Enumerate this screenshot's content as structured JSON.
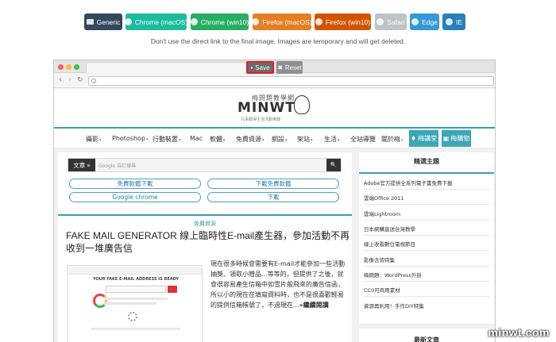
{
  "toolbar": {
    "buttons": [
      {
        "label": "Generic",
        "color": "#34495e",
        "icon": "desktop-icon"
      },
      {
        "label": "Chrome (macOS)",
        "color": "#1abc9c",
        "icon": "chrome-icon"
      },
      {
        "label": "Chrome (win10)",
        "color": "#27ae60",
        "icon": "chrome-icon"
      },
      {
        "label": "Firefox (macOS)",
        "color": "#e67e22",
        "icon": "firefox-icon"
      },
      {
        "label": "Firefox (win10)",
        "color": "#d35400",
        "icon": "firefox-icon"
      },
      {
        "label": "Safari",
        "color": "#bdc3c7",
        "icon": "safari-icon"
      },
      {
        "label": "Edge",
        "color": "#3498db",
        "icon": "edge-icon"
      },
      {
        "label": "IE",
        "color": "#2980b9",
        "icon": "ie-icon"
      }
    ],
    "notice": "Don't use the direct link to the final image. Images are temporary and will get deleted."
  },
  "overlay": {
    "save_label": "Save",
    "reset_label": "Reset",
    "save_color": "#6b6b6b",
    "save_border": "#e02020"
  },
  "browser": {
    "nav_back": "‹",
    "nav_forward": "›",
    "nav_reload": "↻"
  },
  "site": {
    "logo_cn": "梅問題教學網",
    "logo_en": "MINWT",
    "logo_sub": "凡事都得生活活動樂趣",
    "menu": [
      {
        "label": "攝影",
        "caret": "▾"
      },
      {
        "label": "Photoshop",
        "caret": "▾"
      },
      {
        "label": "行動裝置",
        "caret": "▾"
      },
      {
        "label": "Mac",
        "caret": ""
      },
      {
        "label": "軟體",
        "caret": "▾"
      },
      {
        "label": "免費資源",
        "caret": "▾"
      },
      {
        "label": "網設",
        "caret": "▾"
      },
      {
        "label": "架站",
        "caret": "▾"
      },
      {
        "label": "生活",
        "caret": "▾"
      },
      {
        "label": "全站導覽",
        "caret": ""
      },
      {
        "label": "關於梅",
        "caret": "▾"
      }
    ],
    "menu_btn_1": "梅講堂",
    "menu_btn_2": "梅購物",
    "accent": "#3b9eb0",
    "search": {
      "label": "文章",
      "label_arrow": "»",
      "placeholder": "Google 自訂搜尋",
      "button": "🔍"
    },
    "pills": [
      "免費軟體下載",
      "下載免費軟體",
      "Google chrome",
      "下載"
    ],
    "post": {
      "category": "免費資源",
      "title": "FAKE MAIL GENERATOR 線上臨時性E-mail產生器，參加活動不再收到一堆廣告信",
      "thumb_title": "YOUR FAKE E-MAIL ADDRESS IS READY",
      "excerpt": "現在很多時候會需要有E-mail才能參加一些活動抽獎、領取小贈品...等等的，但提供了之後，就會很容易產生信箱中如雪片般飛來的廣告信函，所以小的現在在填寫資料時，也不是很喜歡輕易的提供信箱帳號了，不過現在...",
      "more": "»繼續閱讀"
    },
    "sidebar": {
      "title": "精選主題",
      "items": [
        "Adobe官方提供全系列電子書免費下載",
        "雲端Office 2011",
        "雲端Lightroom",
        "日本網購直送台灣教學",
        "線上收看數位電視節目",
        "影像去背特集",
        "梅問題：WordPress外掛",
        "CC0可商用素材",
        "資源再利用！手作DIY特集"
      ],
      "title2": "最新文章"
    },
    "watermark": "minwt.com"
  }
}
